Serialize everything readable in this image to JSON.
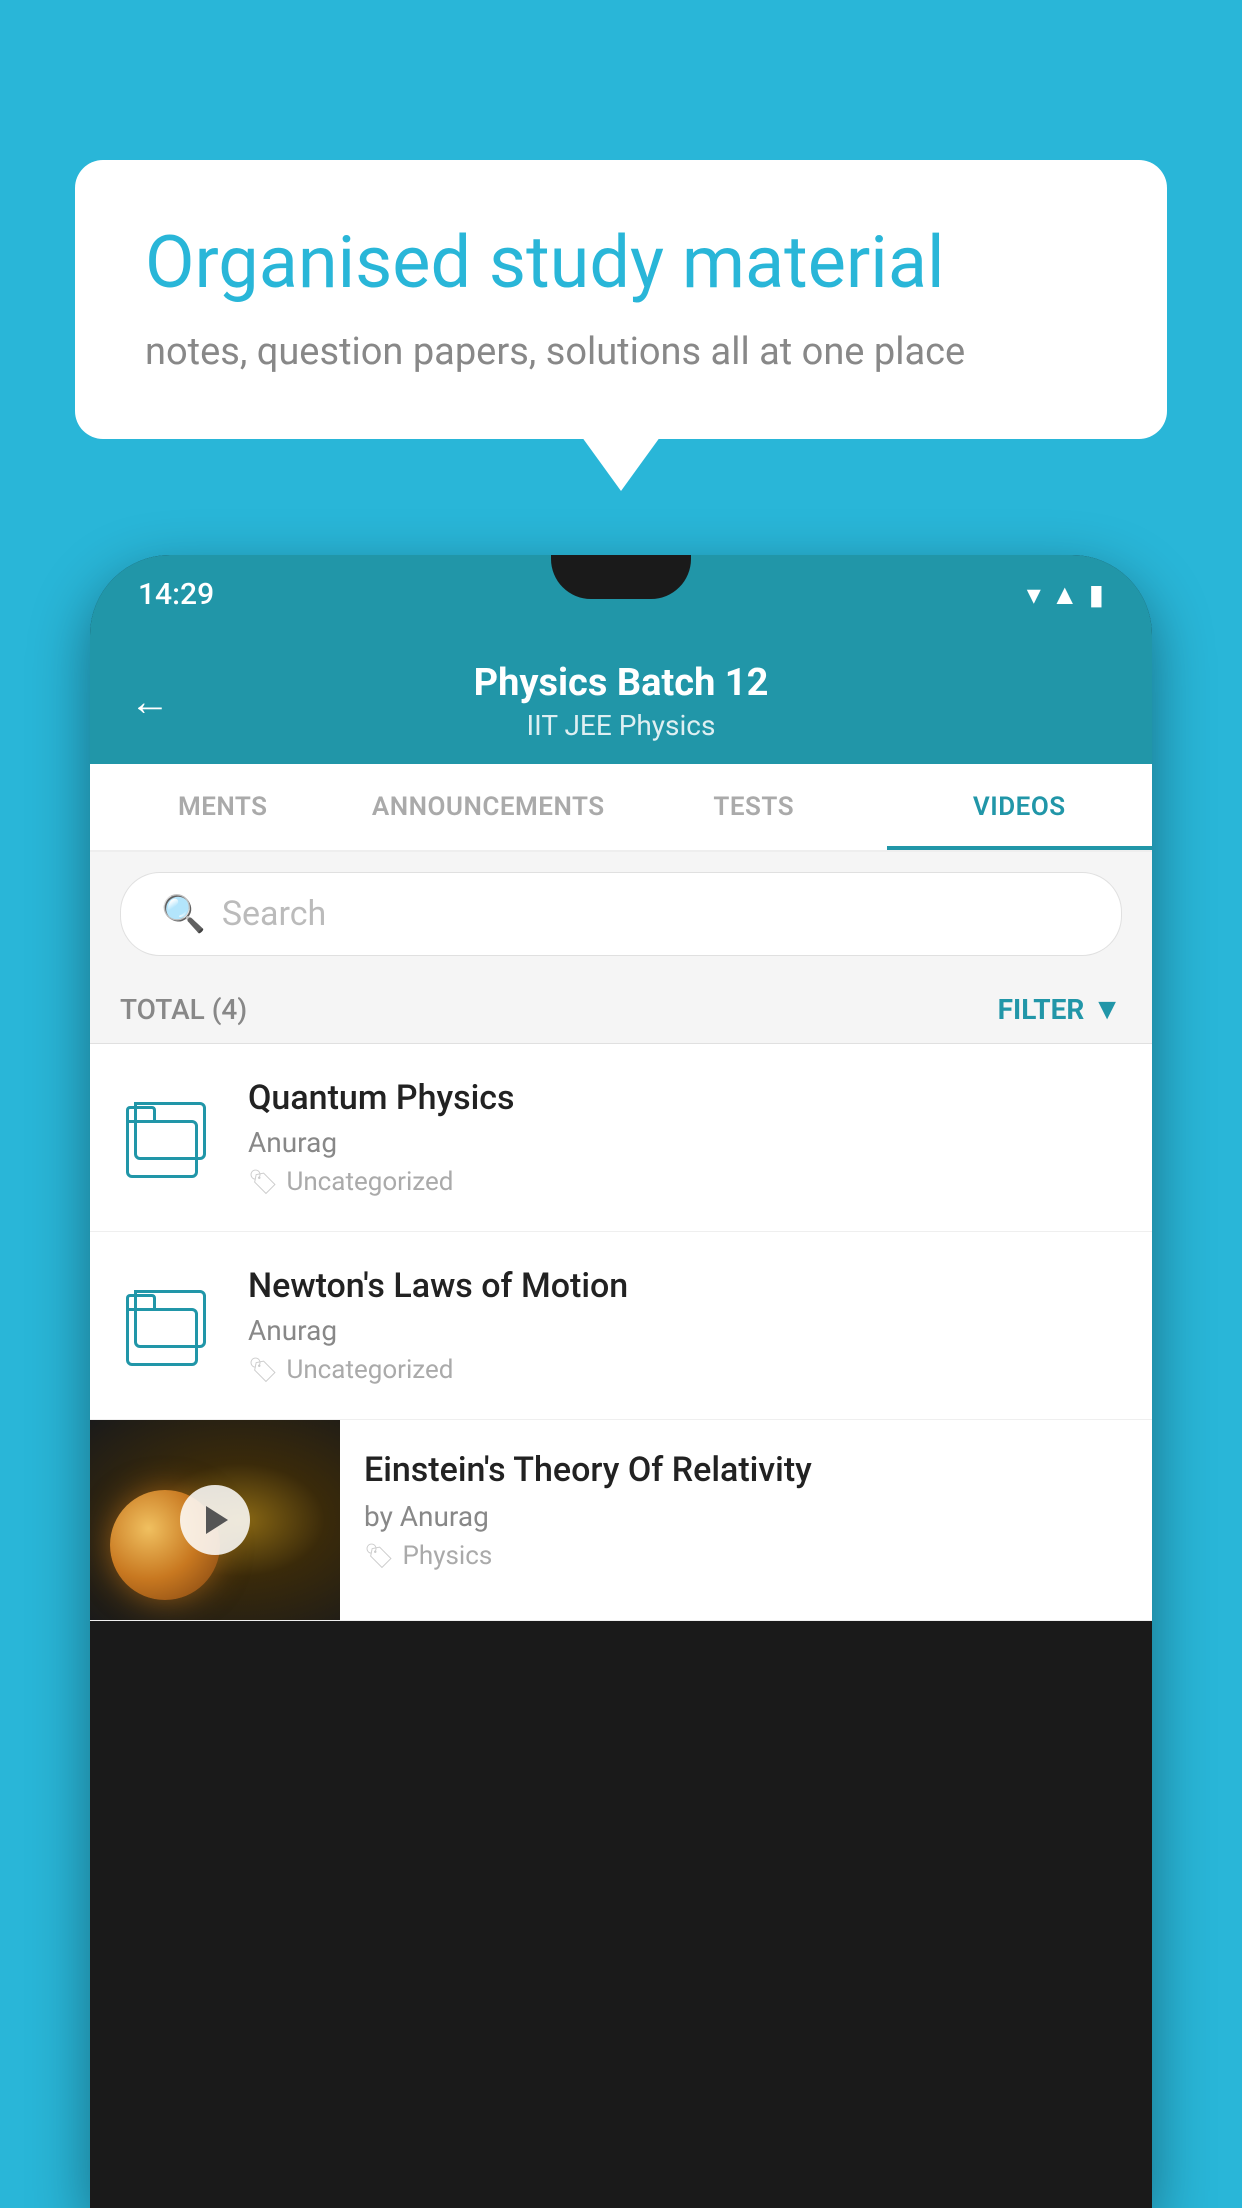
{
  "background_color": "#29b6d8",
  "speech_bubble": {
    "headline": "Organised study material",
    "subline": "notes, question papers, solutions all at one place"
  },
  "phone": {
    "status_bar": {
      "time": "14:29"
    },
    "header": {
      "title": "Physics Batch 12",
      "subtitle": "IIT JEE    Physics",
      "back_label": "←"
    },
    "tabs": [
      {
        "label": "MENTS",
        "active": false
      },
      {
        "label": "ANNOUNCEMENTS",
        "active": false
      },
      {
        "label": "TESTS",
        "active": false
      },
      {
        "label": "VIDEOS",
        "active": true
      }
    ],
    "search": {
      "placeholder": "Search"
    },
    "filter": {
      "total_label": "TOTAL (4)",
      "filter_label": "FILTER"
    },
    "videos": [
      {
        "title": "Quantum Physics",
        "author": "Anurag",
        "tag": "Uncategorized",
        "has_thumb": false
      },
      {
        "title": "Newton's Laws of Motion",
        "author": "Anurag",
        "tag": "Uncategorized",
        "has_thumb": false
      },
      {
        "title": "Einstein's Theory Of Relativity",
        "author": "by Anurag",
        "tag": "Physics",
        "has_thumb": true
      }
    ]
  }
}
